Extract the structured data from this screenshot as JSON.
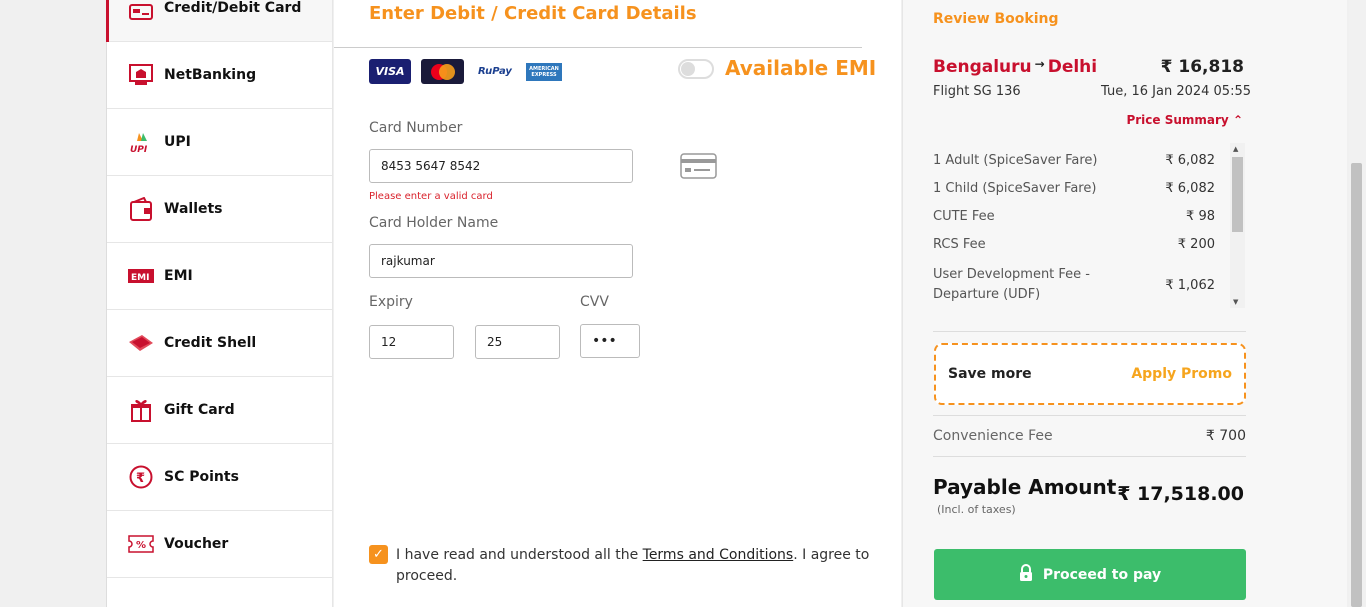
{
  "sidebar": {
    "items": [
      {
        "label": "Credit/Debit Card",
        "icon": "credit-card-icon"
      },
      {
        "label": "NetBanking",
        "icon": "bank-icon"
      },
      {
        "label": "UPI",
        "icon": "upi-icon"
      },
      {
        "label": "Wallets",
        "icon": "wallet-icon"
      },
      {
        "label": "EMI",
        "icon": "emi-icon"
      },
      {
        "label": "Credit Shell",
        "icon": "credit-shell-icon"
      },
      {
        "label": "Gift Card",
        "icon": "gift-icon"
      },
      {
        "label": "SC Points",
        "icon": "rupee-icon"
      },
      {
        "label": "Voucher",
        "icon": "voucher-icon"
      }
    ]
  },
  "main": {
    "title": "Enter Debit / Credit Card Details",
    "card_logos": [
      "VISA",
      "MasterCard",
      "RuPay",
      "AMERICAN EXPRESS"
    ],
    "emi_label": "Available EMI",
    "card_number_label": "Card Number",
    "card_number_value": "8453 5647 8542",
    "card_error": "Please enter a valid card",
    "holder_label": "Card Holder Name",
    "holder_value": "rajkumar",
    "expiry_label": "Expiry",
    "expiry_month": "12",
    "expiry_year": "25",
    "cvv_label": "CVV",
    "cvv_value": "•••",
    "terms_prefix": "I have read and understood all the ",
    "terms_link": "Terms and Conditions",
    "terms_suffix": ". I agree to proceed."
  },
  "summary": {
    "review_label": "Review Booking",
    "origin": "Bengaluru",
    "destination": "Delhi",
    "fare": "₹ 16,818",
    "flight": "Flight  SG 136",
    "date": "Tue, 16 Jan 2024 05:55",
    "price_summary_label": "Price Summary",
    "breakdown": [
      {
        "label": "1 Adult  (SpiceSaver Fare)",
        "amount": "₹ 6,082"
      },
      {
        "label": "1 Child  (SpiceSaver Fare)",
        "amount": "₹ 6,082"
      },
      {
        "label": "CUTE Fee",
        "amount": "₹ 98"
      },
      {
        "label": "RCS Fee",
        "amount": "₹ 200"
      },
      {
        "label": "User Development Fee - Departure (UDF)",
        "amount": "₹ 1,062"
      }
    ],
    "promo_save": "Save more",
    "promo_apply": "Apply Promo",
    "convenience_label": "Convenience Fee",
    "convenience_value": "₹ 700",
    "payable_label": "Payable Amount",
    "incl_taxes": "(Incl. of taxes)",
    "total": "₹ 17,518.00",
    "pay_button": "Proceed to pay"
  },
  "colors": {
    "brand_red": "#c8102e",
    "accent_orange": "#f6921e",
    "pay_green": "#3cbd6b"
  }
}
